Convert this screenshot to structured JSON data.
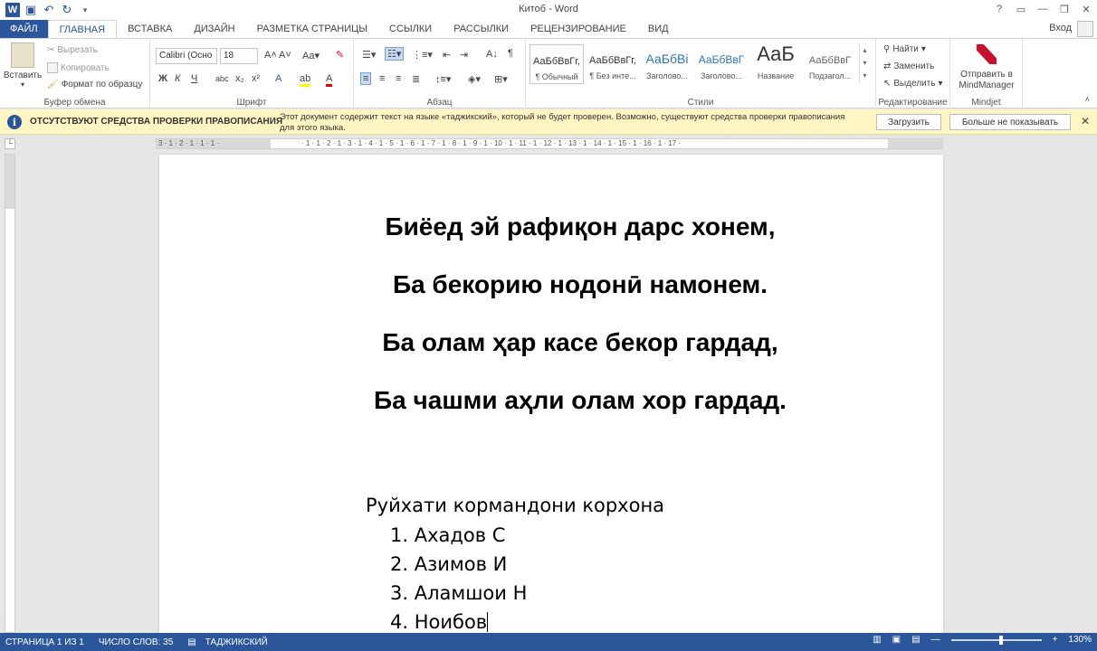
{
  "titlebar": {
    "title": "Китоб - Word"
  },
  "tabs": [
    "ФАЙЛ",
    "ГЛАВНАЯ",
    "ВСТАВКА",
    "ДИЗАЙН",
    "РАЗМЕТКА СТРАНИЦЫ",
    "ССЫЛКИ",
    "РАССЫЛКИ",
    "РЕЦЕНЗИРОВАНИЕ",
    "ВИД"
  ],
  "signin": "Вход",
  "ribbon": {
    "clipboard": {
      "paste": "Вставить",
      "cut": "Вырезать",
      "copy": "Копировать",
      "format_painter": "Формат по образцу",
      "label": "Буфер обмена"
    },
    "font": {
      "name": "Calibri (Осно",
      "size": "18",
      "label": "Шрифт"
    },
    "paragraph": {
      "label": "Абзац"
    },
    "styles": {
      "label": "Стили",
      "items": [
        {
          "preview": "АаБбВвГг,",
          "name": "¶ Обычный"
        },
        {
          "preview": "АаБбВвГг,",
          "name": "¶ Без инте..."
        },
        {
          "preview": "АаБбВі",
          "name": "Заголово..."
        },
        {
          "preview": "АаБбВвГ",
          "name": "Заголово..."
        },
        {
          "preview": "АаБ",
          "name": "Название"
        },
        {
          "preview": "АаБбВвГ",
          "name": "Подзагол..."
        }
      ]
    },
    "editing": {
      "find": "Найти",
      "replace": "Заменить",
      "select": "Выделить",
      "label": "Редактирование"
    },
    "mindjet": {
      "send": "Отправить в MindManager",
      "label": "Mindjet"
    }
  },
  "infobar": {
    "title": "ОТСУТСТВУЮТ СРЕДСТВА ПРОВЕРКИ ПРАВОПИСАНИЯ",
    "message": "Этот документ содержит текст на языке «таджикский», который не будет проверен. Возможно, существуют средства проверки правописания для этого языка.",
    "download": "Загрузить",
    "dont_show": "Больше не показывать"
  },
  "document": {
    "poem": [
      "Биёед эй рафиқон дарс хонем,",
      "Ба бекорию нодонӣ намонем.",
      "Ба олам ҳар касе бекор гардад,",
      "Ба чашми аҳли олам хор гардад."
    ],
    "list_title": "Руйхати кормандони корхона",
    "list": [
      "1. Ахадов С",
      "2. Азимов И",
      "3. Аламшои Н",
      "4. Ноибов"
    ]
  },
  "statusbar": {
    "page": "СТРАНИЦА 1 ИЗ 1",
    "words": "ЧИСЛО СЛОВ: 35",
    "language": "ТАДЖИКСКИЙ",
    "zoom": "130%",
    "zoom_percent": 130
  },
  "colors": {
    "accent": "#2b579a",
    "infobar": "#fff6c3"
  }
}
